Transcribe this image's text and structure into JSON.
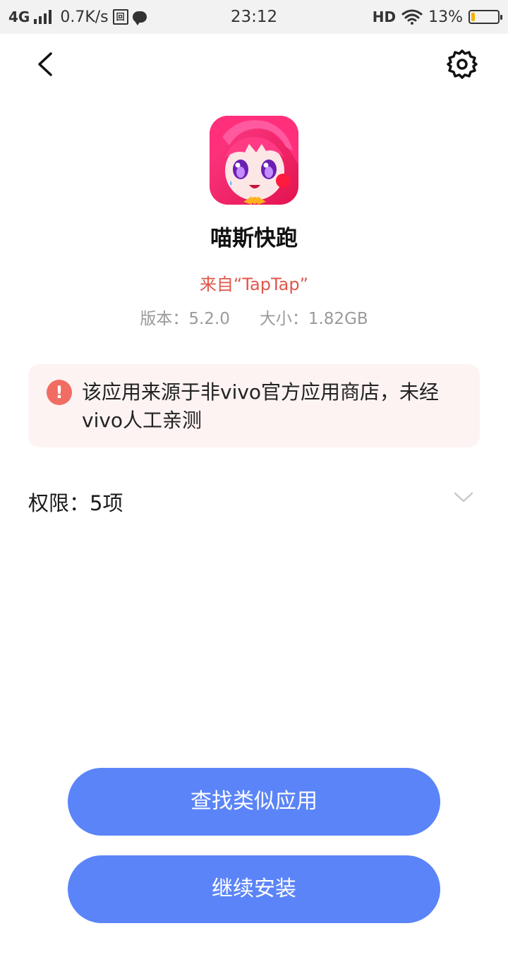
{
  "status_bar": {
    "network": "4G",
    "speed": "0.7K/s",
    "sim_icon_text": "回",
    "time": "23:12",
    "hd": "HD",
    "battery_percent": "13%",
    "battery_level": 0.13,
    "battery_color": "#f5b400"
  },
  "nav": {
    "back_icon": "chevron-left-icon",
    "settings_icon": "gear-icon"
  },
  "app": {
    "name": "喵斯快跑",
    "source": "来自“TapTap”",
    "version": "版本：5.2.0",
    "size": "大小：1.82GB"
  },
  "warning": {
    "text": "该应用来源于非vivo官方应用商店，未经vivo人工亲测",
    "icon_text": "!",
    "accent": "#f16d63"
  },
  "permissions": {
    "label": "权限：5项",
    "icon": "chevron-down-icon"
  },
  "buttons": {
    "find_similar": "查找类似应用",
    "continue_install": "继续安装",
    "color": "#5b84f8"
  }
}
